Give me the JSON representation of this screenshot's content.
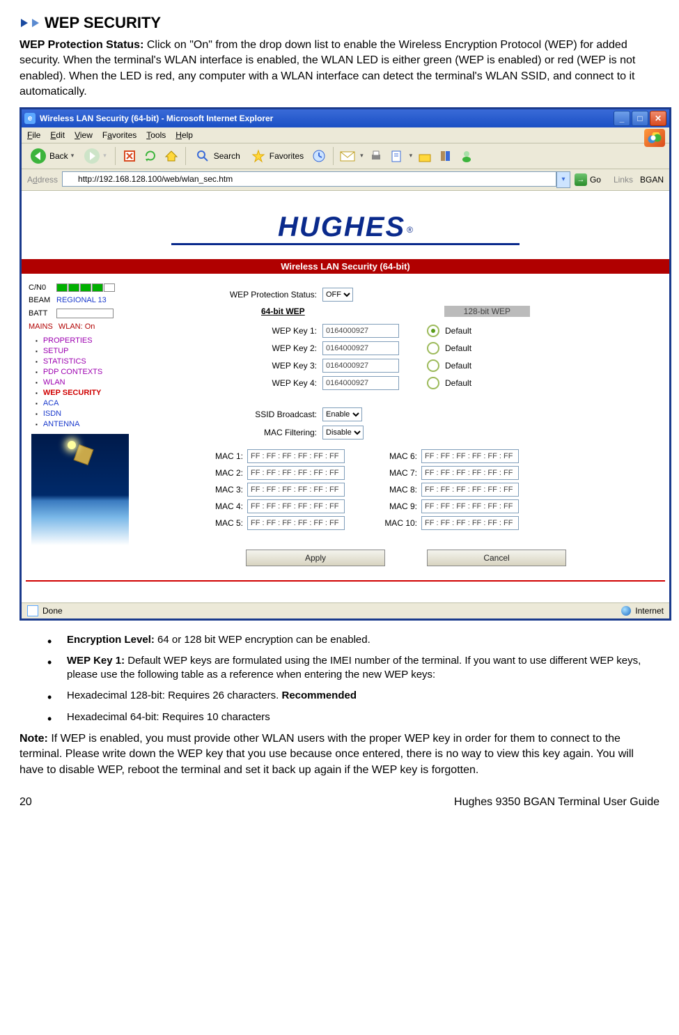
{
  "heading": "WEP SECURITY",
  "intro_label": "WEP Protection Status:",
  "intro_text": "  Click on \"On\" from the drop down list to enable the Wireless Encryption Protocol (WEP) for added security. When the terminal's WLAN interface is enabled, the WLAN LED is either green (WEP is enabled) or red (WEP is not enabled).  When the LED is red, any computer with a WLAN interface can detect the terminal's WLAN SSID, and connect to it automatically.",
  "ie": {
    "title": "Wireless LAN Security (64-bit) - Microsoft Internet Explorer",
    "menus": [
      "File",
      "Edit",
      "View",
      "Favorites",
      "Tools",
      "Help"
    ],
    "back": "Back",
    "search": "Search",
    "favorites": "Favorites",
    "address_label": "Address",
    "url": "http://192.168.128.100/web/wlan_sec.htm",
    "go": "Go",
    "links": "Links",
    "bgan": "BGAN",
    "status_done": "Done",
    "status_zone": "Internet"
  },
  "page": {
    "logo": "HUGHES",
    "banner": "Wireless LAN Security (64-bit)",
    "side": {
      "cno": "C/N0",
      "beam_lbl": "BEAM",
      "beam_val": "REGIONAL 13",
      "batt": "BATT",
      "mains": "MAINS",
      "wlan": "WLAN: On"
    },
    "nav": {
      "properties": "PROPERTIES",
      "setup": "SETUP",
      "statistics": "STATISTICS",
      "pdp": "PDP CONTEXTS",
      "wlan": "WLAN",
      "wep": "WEP SECURITY",
      "aca": "ACA",
      "isdn": "ISDN",
      "antenna": "ANTENNA"
    },
    "fields": {
      "wep_status_lbl": "WEP Protection Status:",
      "wep_status_val": "OFF",
      "tab64": "64-bit WEP",
      "tab128": "128-bit WEP",
      "key_lbl": [
        "WEP Key 1:",
        "WEP Key 2:",
        "WEP Key 3:",
        "WEP Key 4:"
      ],
      "key_val": [
        "0164000927",
        "0164000927",
        "0164000927",
        "0164000927"
      ],
      "default": "Default",
      "ssid_lbl": "SSID Broadcast:",
      "ssid_val": "Enable",
      "macf_lbl": "MAC Filtering:",
      "macf_val": "Disable",
      "mac_labels": [
        "MAC 1:",
        "MAC 2:",
        "MAC 3:",
        "MAC 4:",
        "MAC 5:",
        "MAC 6:",
        "MAC 7:",
        "MAC 8:",
        "MAC 9:",
        "MAC 10:"
      ],
      "mac_val": "FF : FF : FF : FF : FF : FF",
      "apply": "Apply",
      "cancel": "Cancel"
    }
  },
  "bullets": {
    "b1a": "Encryption Level:",
    "b1b": "  64 or 128 bit WEP encryption can be enabled.",
    "b2a": "WEP Key 1:",
    "b2b": "  Default WEP keys are formulated using the IMEI number of the terminal.  If you want to use different WEP keys, please use the following table as a reference when entering the new WEP keys:",
    "b3a": "Hexadecimal 128-bit: Requires 26 characters. ",
    "b3b": "Recommended",
    "b4": "Hexadecimal 64-bit: Requires 10 characters"
  },
  "note_label": "Note:",
  "note_text": "  If WEP is enabled, you must provide other WLAN users with the proper WEP key in order for them to connect to the terminal.  Please write down the WEP key that you use because once entered, there is no way to view this key again.  You will have to disable WEP, reboot the terminal and set it back up again if the WEP key is forgotten.",
  "footer_page": "20",
  "footer_text": "Hughes 9350 BGAN Terminal User Guide"
}
